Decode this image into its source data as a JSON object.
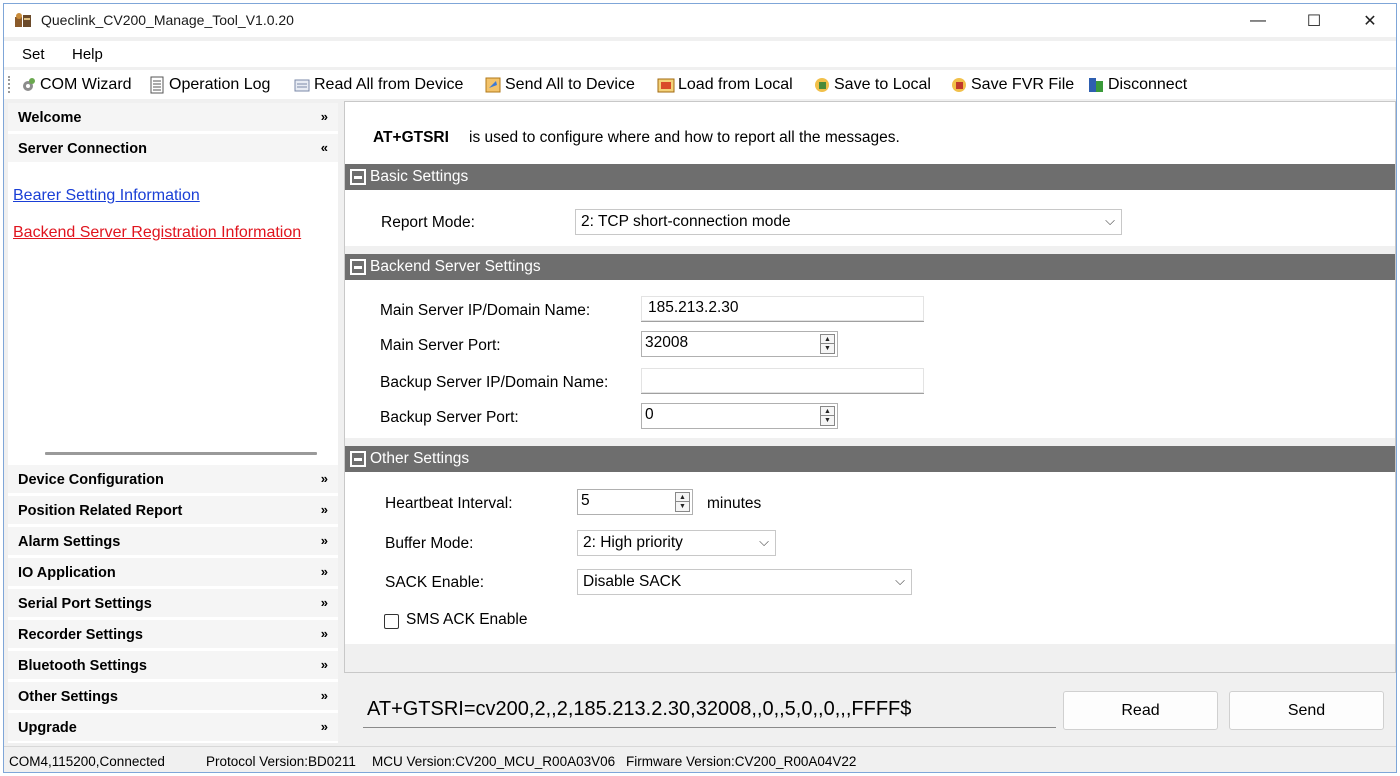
{
  "window": {
    "title": "Queclink_CV200_Manage_Tool_V1.0.20",
    "controls": {
      "minimize": "—",
      "maximize": "☐",
      "close": "✕"
    }
  },
  "menu": {
    "items": [
      "Set",
      "Help"
    ]
  },
  "toolbar": {
    "items": [
      {
        "label": "COM Wizard",
        "icon": "gear-icon"
      },
      {
        "label": "Operation Log",
        "icon": "log-icon"
      },
      {
        "label": "Read All from Device",
        "icon": "read-icon"
      },
      {
        "label": "Send All to Device",
        "icon": "send-icon"
      },
      {
        "label": "Load from Local",
        "icon": "load-icon"
      },
      {
        "label": "Save to Local",
        "icon": "save-icon"
      },
      {
        "label": "Save FVR File",
        "icon": "save-fvr-icon"
      },
      {
        "label": "Disconnect",
        "icon": "disconnect-icon"
      }
    ]
  },
  "sidebar": {
    "top_sections": [
      {
        "label": "Welcome",
        "chevron": "»",
        "expanded": false
      },
      {
        "label": "Server Connection",
        "chevron": "«",
        "expanded": true
      }
    ],
    "links": [
      {
        "label": "Bearer Setting Information",
        "color": "#1a3fd6",
        "active": false
      },
      {
        "label": "Backend Server Registration Information",
        "color": "#e0141e",
        "active": true
      }
    ],
    "bottom_sections": [
      {
        "label": "Device Configuration",
        "chevron": "»"
      },
      {
        "label": "Position Related Report",
        "chevron": "»"
      },
      {
        "label": "Alarm Settings",
        "chevron": "»"
      },
      {
        "label": "IO Application",
        "chevron": "»"
      },
      {
        "label": "Serial Port Settings",
        "chevron": "»"
      },
      {
        "label": "Recorder Settings",
        "chevron": "»"
      },
      {
        "label": "Bluetooth Settings",
        "chevron": "»"
      },
      {
        "label": "Other Settings",
        "chevron": "»"
      },
      {
        "label": "Upgrade",
        "chevron": "»"
      }
    ]
  },
  "main": {
    "intro": {
      "command": "AT+GTSRI",
      "text": "is used to configure where and how to report all the messages."
    },
    "basic": {
      "title": "Basic Settings",
      "report_mode_label": "Report Mode:",
      "report_mode_value": "2: TCP short-connection mode"
    },
    "backend": {
      "title": "Backend Server Settings",
      "main_ip_label": "Main Server IP/Domain Name:",
      "main_ip_value": "185.213.2.30",
      "main_port_label": "Main Server Port:",
      "main_port_value": "32008",
      "backup_ip_label": "Backup Server IP/Domain Name:",
      "backup_ip_value": "",
      "backup_port_label": "Backup Server Port:",
      "backup_port_value": "0"
    },
    "other": {
      "title": "Other Settings",
      "heartbeat_label": "Heartbeat Interval:",
      "heartbeat_value": "5",
      "heartbeat_unit": "minutes",
      "buffer_label": "Buffer Mode:",
      "buffer_value": "2: High priority",
      "sack_label": "SACK Enable:",
      "sack_value": "Disable SACK",
      "sms_ack_label": "SMS ACK Enable",
      "sms_ack_checked": false
    }
  },
  "command_bar": {
    "command": "AT+GTSRI=cv200,2,,2,185.213.2.30,32008,,0,,5,0,,0,,,FFFF$",
    "read_label": "Read",
    "send_label": "Send"
  },
  "status": {
    "connection": "COM4,115200,Connected",
    "protocol": "Protocol Version:BD0211",
    "mcu": "MCU Version:CV200_MCU_R00A03V06",
    "firmware": "Firmware Version:CV200_R00A04V22"
  }
}
